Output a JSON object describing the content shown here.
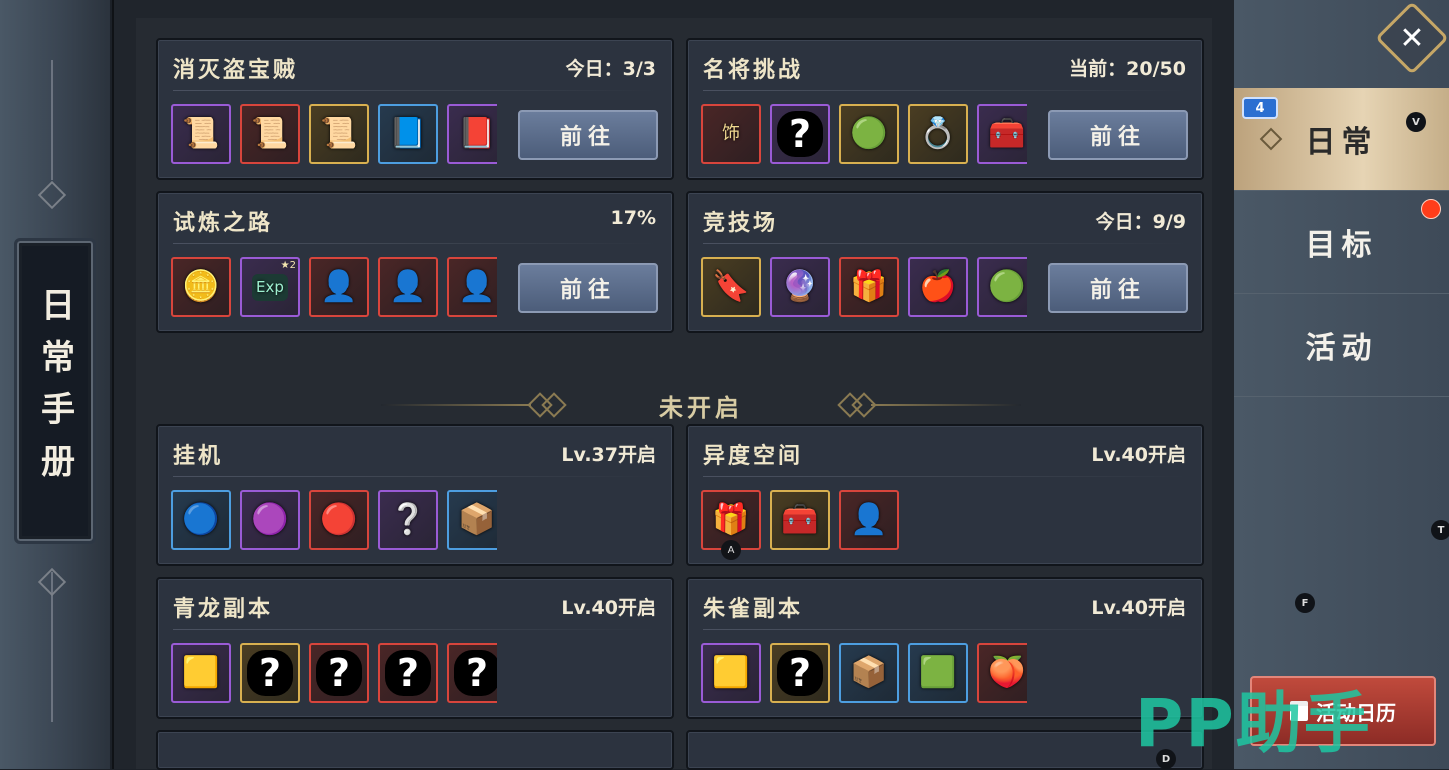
{
  "side_title": "日常手册",
  "colors": {
    "accent_gold": "#c6a766",
    "button_blue": "#5a6c8a",
    "badge_blue": "#2b6fd1",
    "alert_red": "#ff3d1a",
    "watermark_green": "#1ec7a2"
  },
  "cards": [
    {
      "title": "消灭盗宝贼",
      "status": "今日：3/3",
      "button": "前往",
      "items": [
        {
          "frame": "purple",
          "icon": "scroll-icon"
        },
        {
          "frame": "red",
          "icon": "scroll-icon"
        },
        {
          "frame": "gold",
          "icon": "scroll-icon"
        },
        {
          "frame": "blue",
          "icon": "book-icon"
        },
        {
          "frame": "purple",
          "icon": "book-icon"
        }
      ]
    },
    {
      "title": "名将挑战",
      "status": "当前：20/50",
      "button": "前往",
      "items": [
        {
          "frame": "red",
          "icon": "badge-icon",
          "glyph": "饰"
        },
        {
          "frame": "purple",
          "icon": "mystery-icon",
          "glyph": "?"
        },
        {
          "frame": "gold",
          "icon": "jade-pendant-icon"
        },
        {
          "frame": "gold",
          "icon": "ring-icon"
        },
        {
          "frame": "purple",
          "icon": "chest-icon"
        }
      ]
    },
    {
      "title": "试炼之路",
      "status": "17%",
      "button": "前往",
      "items": [
        {
          "frame": "red",
          "icon": "coin-icon"
        },
        {
          "frame": "purple",
          "icon": "exp-icon",
          "glyph": "Exp",
          "corner": "★2"
        },
        {
          "frame": "red",
          "icon": "hero-portrait-icon"
        },
        {
          "frame": "red",
          "icon": "hero-portrait-icon"
        },
        {
          "frame": "red",
          "icon": "hero-portrait-icon"
        }
      ]
    },
    {
      "title": "竞技场",
      "status": "今日：9/9",
      "button": "前往",
      "items": [
        {
          "frame": "gold",
          "icon": "token-icon"
        },
        {
          "frame": "purple",
          "icon": "orb-icon"
        },
        {
          "frame": "red",
          "icon": "red-box-icon"
        },
        {
          "frame": "purple",
          "icon": "fruit-icon"
        },
        {
          "frame": "purple",
          "icon": "green-orb-icon"
        }
      ]
    },
    {
      "title": "挂机",
      "status": "Lv.37开启",
      "items": [
        {
          "frame": "blue",
          "icon": "blue-orb-icon"
        },
        {
          "frame": "purple",
          "icon": "purple-orb-icon"
        },
        {
          "frame": "red",
          "icon": "red-orb-icon"
        },
        {
          "frame": "purple",
          "icon": "mystery-portrait-icon"
        },
        {
          "frame": "blue",
          "icon": "tray-icon"
        }
      ]
    },
    {
      "title": "异度空间",
      "status": "Lv.40开启",
      "items": [
        {
          "frame": "red",
          "icon": "red-box-icon",
          "foot": "A"
        },
        {
          "frame": "gold",
          "icon": "chest-icon"
        },
        {
          "frame": "red",
          "icon": "hero-portrait-icon"
        }
      ]
    },
    {
      "title": "青龙副本",
      "status": "Lv.40开启",
      "items": [
        {
          "frame": "purple",
          "icon": "gold-tablet-icon"
        },
        {
          "frame": "gold",
          "icon": "mystery-icon",
          "glyph": "?"
        },
        {
          "frame": "red",
          "icon": "mystery-icon",
          "glyph": "?"
        },
        {
          "frame": "red",
          "icon": "mystery-icon",
          "glyph": "?"
        },
        {
          "frame": "red",
          "icon": "mystery-icon",
          "glyph": "?"
        }
      ]
    },
    {
      "title": "朱雀副本",
      "status": "Lv.40开启",
      "items": [
        {
          "frame": "purple",
          "icon": "gold-tablet-icon"
        },
        {
          "frame": "gold",
          "icon": "mystery-icon",
          "glyph": "?"
        },
        {
          "frame": "blue",
          "icon": "tray-icon"
        },
        {
          "frame": "blue",
          "icon": "jade-icon"
        },
        {
          "frame": "red",
          "icon": "peach-icon"
        }
      ]
    }
  ],
  "divider_label": "未开启",
  "nav": {
    "items": [
      {
        "label": "日常",
        "active": true
      },
      {
        "label": "目标"
      },
      {
        "label": "活动"
      }
    ],
    "badge": "4",
    "calendar_button": "活动日历"
  },
  "key_hints": [
    "V",
    "T",
    "F",
    "D"
  ],
  "watermark": "PP助手"
}
